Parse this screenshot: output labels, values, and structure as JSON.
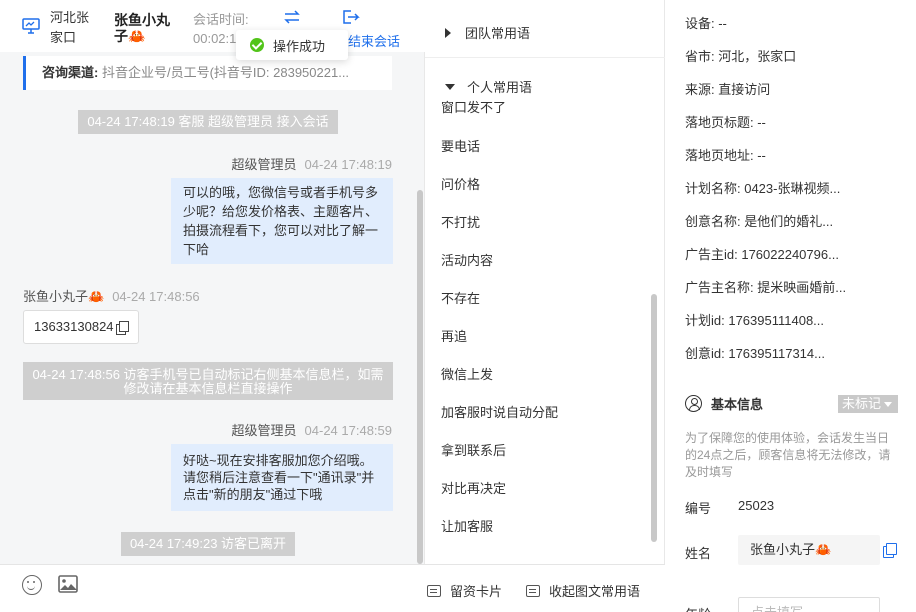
{
  "header": {
    "region": "河北张家口",
    "visitor_name": "张鱼小丸子🦀",
    "time_label": "会话时间:",
    "time_value": "00:02:1",
    "end_label": "结束会话",
    "toast": "操作成功"
  },
  "channel": {
    "label": "咨询渠道:",
    "value": "抖音企业号/员工号(抖音号ID: 283950221..."
  },
  "messages": {
    "sys1": "04-24 17:48:19 客服 超级管理员 接入会话",
    "agent1_name": "超级管理员",
    "agent1_time": "04-24 17:48:19",
    "agent1_text": "可以的哦，您微信号或者手机号多少呢？给您发价格表、主题客片、拍摄流程看下，您可以对比了解一下哈",
    "visitor1_name": "张鱼小丸子🦀",
    "visitor1_time": "04-24 17:48:56",
    "visitor1_text": "13633130824",
    "sys2": "04-24 17:48:56 访客手机号已自动标记右侧基本信息栏，如需修改请在基本信息栏直接操作",
    "agent2_name": "超级管理员",
    "agent2_time": "04-24 17:48:59",
    "agent2_text": "好哒~现在安排客服加您介绍哦。请您稍后注意查看一下\"通讯录\"并点击\"新的朋友\"通过下哦",
    "sys3": "04-24 17:49:23 访客已离开"
  },
  "phrases": {
    "team_group": "团队常用语",
    "personal_group": "个人常用语",
    "items": [
      "窗口发不了",
      "要电话",
      "问价格",
      "不打扰",
      "活动内容",
      "不存在",
      "再追",
      "微信上发",
      "加客服时说自动分配",
      "拿到联系后",
      "对比再决定",
      "让加客服"
    ],
    "card_btn": "留资卡片",
    "collapse_btn": "收起图文常用语"
  },
  "info": {
    "device": "设备: --",
    "province": "省市: 河北，张家口",
    "source": "来源: 直接访问",
    "landing_title": "落地页标题: --",
    "landing_url": "落地页地址: --",
    "plan_name": "计划名称: 0423-张琳视频...",
    "creative_name": "创意名称: 是他们的婚礼...",
    "advertiser_id": "广告主id: 176022240796...",
    "advertiser_name": "广告主名称: 提米映画婚前...",
    "plan_id": "计划id: 176395111408...",
    "creative_id": "创意id: 176395117314...",
    "basic_title": "基本信息",
    "tag_select": "未标记",
    "notice": "为了保障您的使用体验，会话发生当日的24点之后，顾客信息将无法修改，请及时填写",
    "number_label": "编号",
    "number_value": "25023",
    "name_label": "姓名",
    "name_value": "张鱼小丸子🦀",
    "age_label": "年龄",
    "age_placeholder": "点击填写"
  },
  "colors": {
    "accent": "#1f6feb",
    "agent_bubble": "#e1edfd",
    "system_msg": "#cfcfcf",
    "success": "#52c41a"
  }
}
